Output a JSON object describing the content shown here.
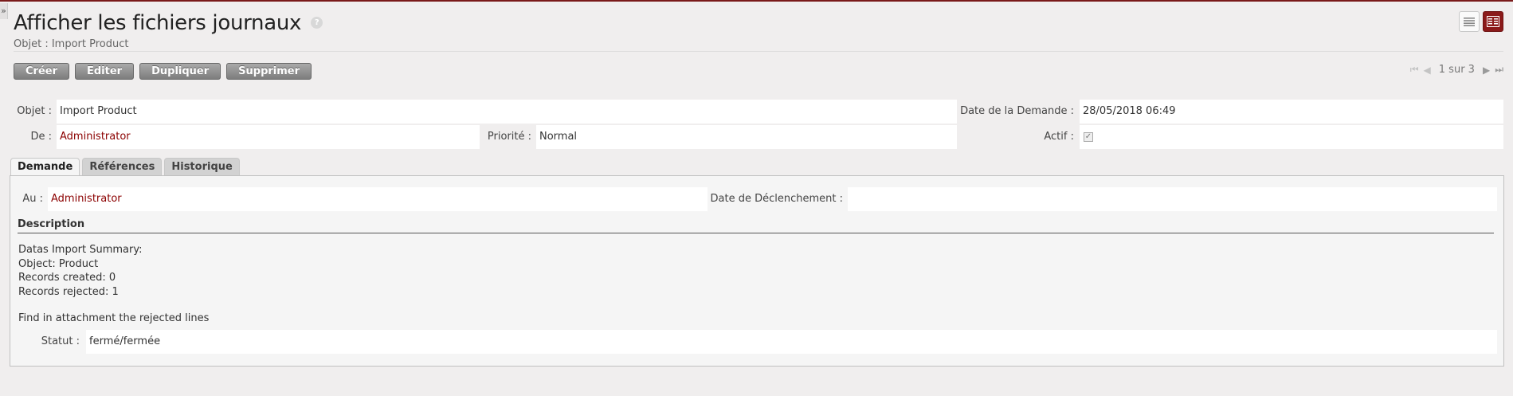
{
  "header": {
    "title": "Afficher les fichiers journaux",
    "help": "?",
    "subtitle": "Objet : Import Product"
  },
  "toolbar": {
    "create": "Créer",
    "edit": "Editer",
    "duplicate": "Dupliquer",
    "delete": "Supprimer"
  },
  "pager": {
    "text": "1 sur 3"
  },
  "form": {
    "objet_label": "Objet :",
    "objet_value": "Import Product",
    "date_label": "Date de la Demande :",
    "date_value": "28/05/2018 06:49",
    "de_label": "De :",
    "de_value": "Administrator",
    "priorite_label": "Priorité :",
    "priorite_value": "Normal",
    "actif_label": "Actif :",
    "actif_checked": true
  },
  "tabs": [
    "Demande",
    "Références",
    "Historique"
  ],
  "demande": {
    "au_label": "Au :",
    "au_value": "Administrator",
    "declenchement_label": "Date de Déclenchement :",
    "declenchement_value": "",
    "description_title": "Description",
    "description_lines": [
      "Datas Import Summary:",
      "Object: Product",
      "Records created: 0",
      "Records rejected: 1"
    ],
    "description_last": "Find in attachment the rejected lines",
    "statut_label": "Statut :",
    "statut_value": "fermé/fermée"
  },
  "colors": {
    "accent": "#8b1a1a",
    "link": "#8b0000"
  }
}
